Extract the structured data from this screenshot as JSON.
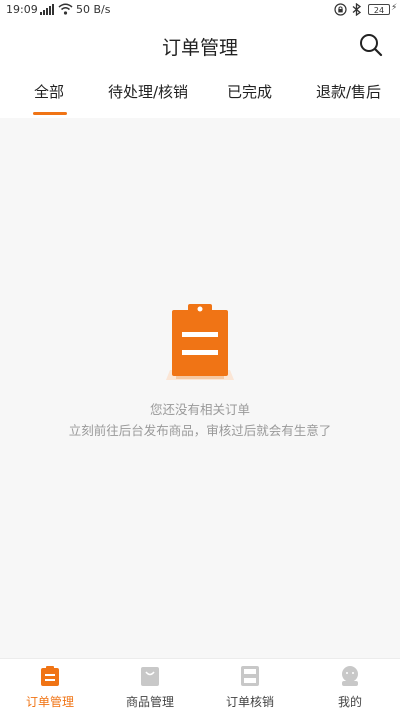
{
  "status_bar": {
    "time": "19:09",
    "net_speed": "50 B/s",
    "battery": "24"
  },
  "header": {
    "title": "订单管理"
  },
  "tabs": [
    {
      "label": "全部",
      "active": true
    },
    {
      "label": "待处理/核销",
      "active": false
    },
    {
      "label": "已完成",
      "active": false
    },
    {
      "label": "退款/售后",
      "active": false
    }
  ],
  "empty_state": {
    "line1": "您还没有相关订单",
    "line2": "立刻前往后台发布商品，审核过后就会有生意了"
  },
  "bottom_nav": [
    {
      "label": "订单管理",
      "icon": "clipboard-icon",
      "active": true
    },
    {
      "label": "商品管理",
      "icon": "bag-icon",
      "active": false
    },
    {
      "label": "订单核销",
      "icon": "scan-icon",
      "active": false
    },
    {
      "label": "我的",
      "icon": "user-icon",
      "active": false
    }
  ],
  "colors": {
    "accent": "#f07415",
    "inactive_icon": "#c8c8c8"
  }
}
